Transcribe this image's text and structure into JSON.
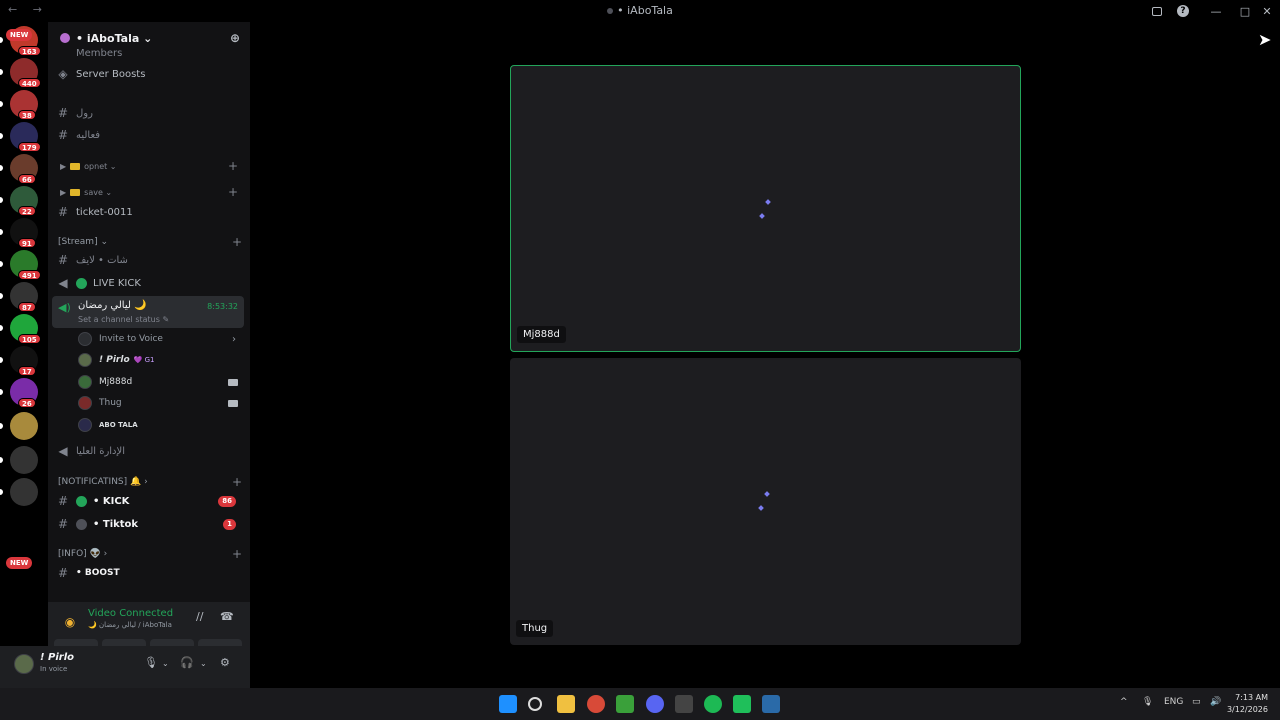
{
  "window": {
    "title": "• iAboTala",
    "nav": "← →",
    "help_icon": "?",
    "minimize": "—",
    "maximize": "□",
    "close": "✕"
  },
  "guilds": {
    "badges": [
      "163",
      "440",
      "38",
      "179",
      "66",
      "22",
      "91",
      "491",
      "87",
      "105",
      "17",
      "26"
    ],
    "new_label": "NEW",
    "colors": [
      "#c0392b",
      "#8e2b2b",
      "#a33",
      "#2a2a5a",
      "#6a3c2c",
      "#2e5a3a",
      "#111",
      "#2a7a2a",
      "#333",
      "#1fa63b",
      "#111",
      "#7a2ca8",
      "#a88a3c",
      "#333",
      "#333"
    ]
  },
  "server": {
    "name": "• iAboTala ⌄",
    "boosts_label": "Server Boosts",
    "members_label": "Members"
  },
  "channels": {
    "rol": "رول",
    "faaliya": "فعاليه",
    "opnet_cat": "opnet ⌄",
    "save_cat": "save ⌄",
    "ticket": "ticket-0011",
    "stream_cat": "[Stream] ⌄",
    "chat_live": "شات • لايف",
    "live_kick": "LIVE KICK",
    "active_voice": {
      "name": "ليالي رمضان 🌙",
      "timer": "8:53:32",
      "status": "Set a channel status ✎"
    },
    "invite": "Invite to Voice",
    "voice_users": [
      {
        "name": "! Pirlo",
        "tag": "💜 G1",
        "color": "#5a6a4a"
      },
      {
        "name": "Mj888d",
        "tag": "",
        "color": "#3a6a3a"
      },
      {
        "name": "Thug",
        "tag": "",
        "color": "#7a2a2a"
      },
      {
        "name": "ABO TALA",
        "tag": "",
        "color": "#2a2a4a"
      }
    ],
    "admin_voice": "الإدارة العليا",
    "notif_cat": "[NOTIFICATINS] 🔔 ›",
    "kick": "• KICK",
    "kick_badge": "86",
    "tiktok": "• Tiktok",
    "tiktok_badge": "1",
    "info_cat": "[INFO] 👽 ›",
    "boost": "• BOOST"
  },
  "voice_panel": {
    "title": "Video Connected",
    "subtitle": "🌙 ليالي رمضان / iAboTala"
  },
  "user": {
    "name": "! Pirlo",
    "status": "In voice"
  },
  "tiles": [
    {
      "name": "Mj888d",
      "speaking": true
    },
    {
      "name": "Thug",
      "speaking": false
    }
  ],
  "taskbar": {
    "lang": "ENG",
    "time": "7:13 AM",
    "date": "3/12/2026",
    "app_colors": [
      "#1e90ff",
      "#3a3a3a",
      "#f0c040",
      "#d84a38",
      "#3aa03a",
      "#5865f2",
      "#444",
      "#1db954",
      "#1fbf5a",
      "#2a6aa8"
    ]
  },
  "colors": {
    "accent_green": "#23a55a",
    "badge_red": "#da373c",
    "sidebar_bg": "#121214"
  }
}
